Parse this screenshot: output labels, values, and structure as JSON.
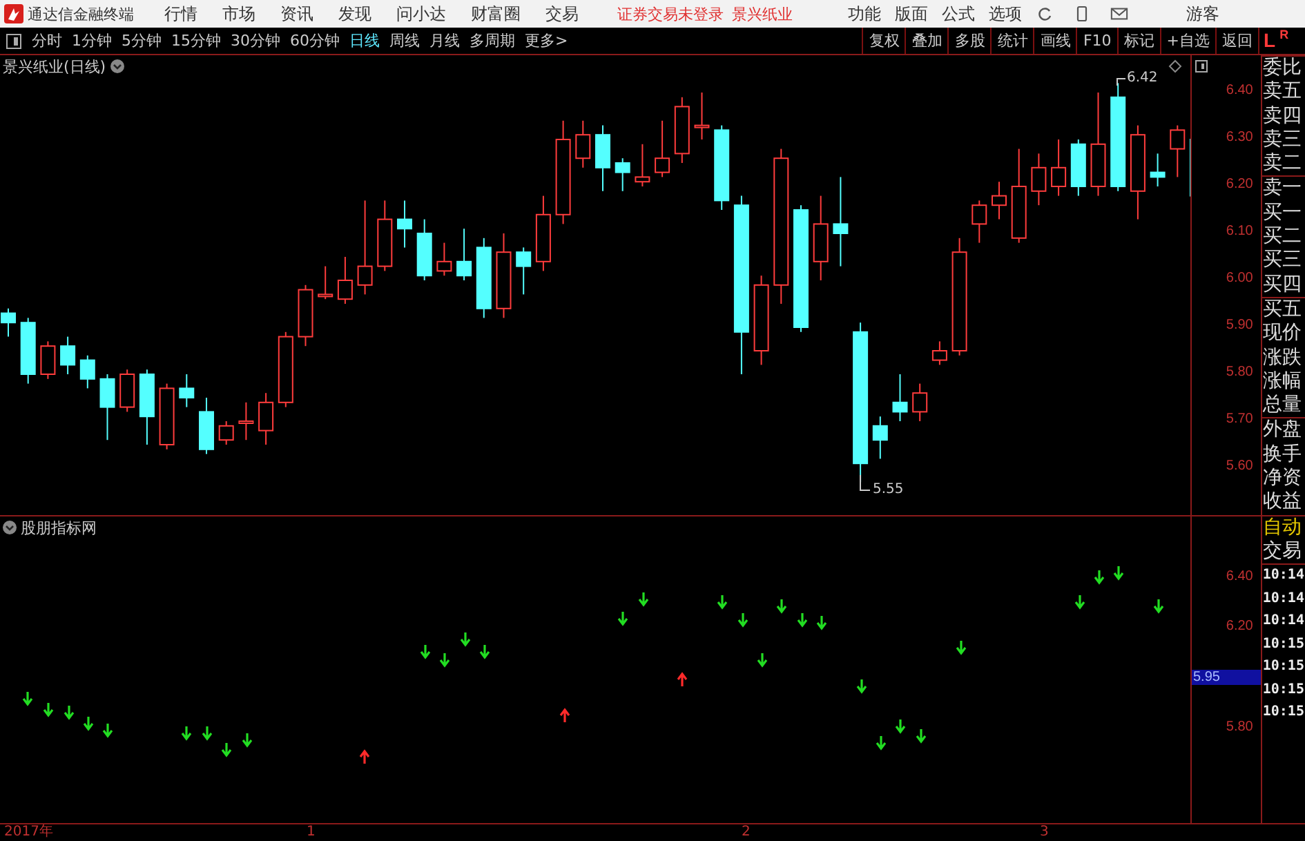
{
  "app_bar": {
    "title": "通达信金融终端",
    "menus": [
      "行情",
      "市场",
      "资讯",
      "发现",
      "问小达",
      "财富圈",
      "交易"
    ],
    "notices": [
      "证券交易未登录",
      "景兴纸业"
    ],
    "tools": [
      "功能",
      "版面",
      "公式",
      "选项"
    ],
    "user": "游客"
  },
  "toolbar": {
    "periods": [
      {
        "label": "分时",
        "selected": false
      },
      {
        "label": "1分钟",
        "selected": false
      },
      {
        "label": "5分钟",
        "selected": false
      },
      {
        "label": "15分钟",
        "selected": false
      },
      {
        "label": "30分钟",
        "selected": false
      },
      {
        "label": "60分钟",
        "selected": false
      },
      {
        "label": "日线",
        "selected": true
      },
      {
        "label": "周线",
        "selected": false
      },
      {
        "label": "月线",
        "selected": false
      },
      {
        "label": "多周期",
        "selected": false
      },
      {
        "label": "更多>",
        "selected": false
      }
    ],
    "actions": [
      "复权",
      "叠加",
      "多股",
      "统计",
      "画线",
      "F10",
      "标记",
      "+自选",
      "返回"
    ],
    "side_tabs": [
      "L",
      "R"
    ]
  },
  "main_chart": {
    "title": "景兴纸业(日线)",
    "price_ticks": [
      "6.40",
      "6.30",
      "6.20",
      "6.10",
      "6.00",
      "5.90",
      "5.80",
      "5.70",
      "5.60"
    ],
    "high_label": "6.42",
    "low_label": "5.55"
  },
  "indicator": {
    "title": "股朋指标网",
    "ticks": [
      "6.40",
      "6.20",
      "5.80"
    ],
    "current_value": "5.95"
  },
  "quote_labels": [
    "委比",
    "卖五",
    "卖四",
    "卖三",
    "卖二",
    "卖一",
    "买一",
    "买二",
    "买三",
    "买四",
    "买五",
    "现价",
    "涨跌",
    "涨幅",
    "总量",
    "外盘",
    "换手",
    "净资",
    "收益"
  ],
  "trade_panel": {
    "tabs": [
      "自动",
      "交易"
    ],
    "times": [
      "10:14",
      "10:14",
      "10:14",
      "10:15",
      "10:15",
      "10:15",
      "10:15"
    ]
  },
  "date_axis": [
    "2017年",
    "1",
    "2",
    "3"
  ]
}
